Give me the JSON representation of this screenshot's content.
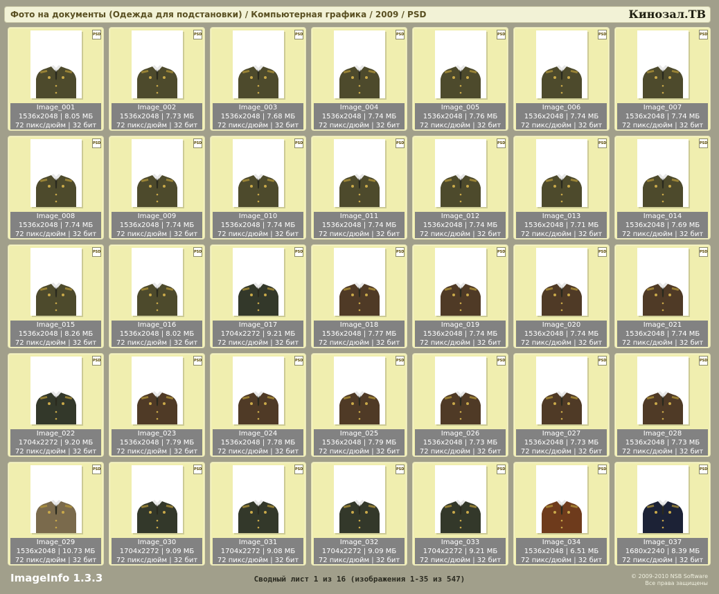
{
  "header": {
    "title": "Фото на документы (Одежда для подстановки) / Компьютерная графика / 2009 / PSD",
    "brand": "Кинозал.ТВ"
  },
  "badge_label": "PSD",
  "images": [
    {
      "name": "Image_001",
      "dims": "1536x2048 | 8.05 МБ",
      "res": "72 пикс/дюйм | 32 бит",
      "variant": "olive"
    },
    {
      "name": "Image_002",
      "dims": "1536x2048 | 7.73 МБ",
      "res": "72 пикс/дюйм | 32 бит",
      "variant": "olive"
    },
    {
      "name": "Image_003",
      "dims": "1536x2048 | 7.68 МБ",
      "res": "72 пикс/дюйм | 32 бит",
      "variant": "olive"
    },
    {
      "name": "Image_004",
      "dims": "1536x2048 | 7.74 МБ",
      "res": "72 пикс/дюйм | 32 бит",
      "variant": "olive"
    },
    {
      "name": "Image_005",
      "dims": "1536x2048 | 7.76 МБ",
      "res": "72 пикс/дюйм | 32 бит",
      "variant": "olive"
    },
    {
      "name": "Image_006",
      "dims": "1536x2048 | 7.74 МБ",
      "res": "72 пикс/дюйм | 32 бит",
      "variant": "olive"
    },
    {
      "name": "Image_007",
      "dims": "1536x2048 | 7.74 МБ",
      "res": "72 пикс/дюйм | 32 бит",
      "variant": "olive"
    },
    {
      "name": "Image_008",
      "dims": "1536x2048 | 7.74 МБ",
      "res": "72 пикс/дюйм | 32 бит",
      "variant": "olive"
    },
    {
      "name": "Image_009",
      "dims": "1536x2048 | 7.74 МБ",
      "res": "72 пикс/дюйм | 32 бит",
      "variant": "olive"
    },
    {
      "name": "Image_010",
      "dims": "1536x2048 | 7.74 МБ",
      "res": "72 пикс/дюйм | 32 бит",
      "variant": "olive"
    },
    {
      "name": "Image_011",
      "dims": "1536x2048 | 7.74 МБ",
      "res": "72 пикс/дюйм | 32 бит",
      "variant": "olive"
    },
    {
      "name": "Image_012",
      "dims": "1536x2048 | 7.74 МБ",
      "res": "72 пикс/дюйм | 32 бит",
      "variant": "olive"
    },
    {
      "name": "Image_013",
      "dims": "1536x2048 | 7.71 МБ",
      "res": "72 пикс/дюйм | 32 бит",
      "variant": "olive"
    },
    {
      "name": "Image_014",
      "dims": "1536x2048 | 7.69 МБ",
      "res": "72 пикс/дюйм | 32 бит",
      "variant": "olive"
    },
    {
      "name": "Image_015",
      "dims": "1536x2048 | 8.26 МБ",
      "res": "72 пикс/дюйм | 32 бит",
      "variant": "olive"
    },
    {
      "name": "Image_016",
      "dims": "1536x2048 | 8.02 МБ",
      "res": "72 пикс/дюйм | 32 бит",
      "variant": "olive"
    },
    {
      "name": "Image_017",
      "dims": "1704x2272 | 9.21 МБ",
      "res": "72 пикс/дюйм | 32 бит",
      "variant": "dark"
    },
    {
      "name": "Image_018",
      "dims": "1536x2048 | 7.77 МБ",
      "res": "72 пикс/дюйм | 32 бит",
      "variant": "brown"
    },
    {
      "name": "Image_019",
      "dims": "1536x2048 | 7.74 МБ",
      "res": "72 пикс/дюйм | 32 бит",
      "variant": "brown"
    },
    {
      "name": "Image_020",
      "dims": "1536x2048 | 7.74 МБ",
      "res": "72 пикс/дюйм | 32 бит",
      "variant": "brown"
    },
    {
      "name": "Image_021",
      "dims": "1536x2048 | 7.74 МБ",
      "res": "72 пикс/дюйм | 32 бит",
      "variant": "brown"
    },
    {
      "name": "Image_022",
      "dims": "1704x2272 | 9.20 МБ",
      "res": "72 пикс/дюйм | 32 бит",
      "variant": "dark"
    },
    {
      "name": "Image_023",
      "dims": "1536x2048 | 7.79 МБ",
      "res": "72 пикс/дюйм | 32 бит",
      "variant": "brown"
    },
    {
      "name": "Image_024",
      "dims": "1536x2048 | 7.78 МБ",
      "res": "72 пикс/дюйм | 32 бит",
      "variant": "brown"
    },
    {
      "name": "Image_025",
      "dims": "1536x2048 | 7.79 МБ",
      "res": "72 пикс/дюйм | 32 бит",
      "variant": "brown"
    },
    {
      "name": "Image_026",
      "dims": "1536x2048 | 7.73 МБ",
      "res": "72 пикс/дюйм | 32 бит",
      "variant": "brown"
    },
    {
      "name": "Image_027",
      "dims": "1536x2048 | 7.73 МБ",
      "res": "72 пикс/дюйм | 32 бит",
      "variant": "brown"
    },
    {
      "name": "Image_028",
      "dims": "1536x2048 | 7.73 МБ",
      "res": "72 пикс/дюйм | 32 бит",
      "variant": "brown"
    },
    {
      "name": "Image_029",
      "dims": "1536x2048 | 10.73 МБ",
      "res": "72 пикс/дюйм | 32 бит",
      "variant": "khaki"
    },
    {
      "name": "Image_030",
      "dims": "1704x2272 | 9.09 МБ",
      "res": "72 пикс/дюйм | 32 бит",
      "variant": "dark"
    },
    {
      "name": "Image_031",
      "dims": "1704x2272 | 9.08 МБ",
      "res": "72 пикс/дюйм | 32 бит",
      "variant": "dark"
    },
    {
      "name": "Image_032",
      "dims": "1704x2272 | 9.09 МБ",
      "res": "72 пикс/дюйм | 32 бит",
      "variant": "dark"
    },
    {
      "name": "Image_033",
      "dims": "1704x2272 | 9.21 МБ",
      "res": "72 пикс/дюйм | 32 бит",
      "variant": "dark"
    },
    {
      "name": "Image_034",
      "dims": "1536x2048 | 6.51 МБ",
      "res": "72 пикс/дюйм | 32 бит",
      "variant": "rust"
    },
    {
      "name": "Image_037",
      "dims": "1680x2240 | 8.39 МБ",
      "res": "72 пикс/дюйм | 32 бит",
      "variant": "navy"
    }
  ],
  "uniform_colors": {
    "olive": "#4d4a2c",
    "dark": "#33382a",
    "brown": "#4f3a26",
    "khaki": "#7a6a4c",
    "rust": "#6e3b1c",
    "navy": "#1c2236"
  },
  "footer": {
    "app": "ImageInfo 1.3.3",
    "summary": "Сводный лист 1 из 16 (изображения 1-35 из 547)",
    "copyright": "© 2009-2010 NSB Software",
    "rights": "Все права защищены"
  }
}
